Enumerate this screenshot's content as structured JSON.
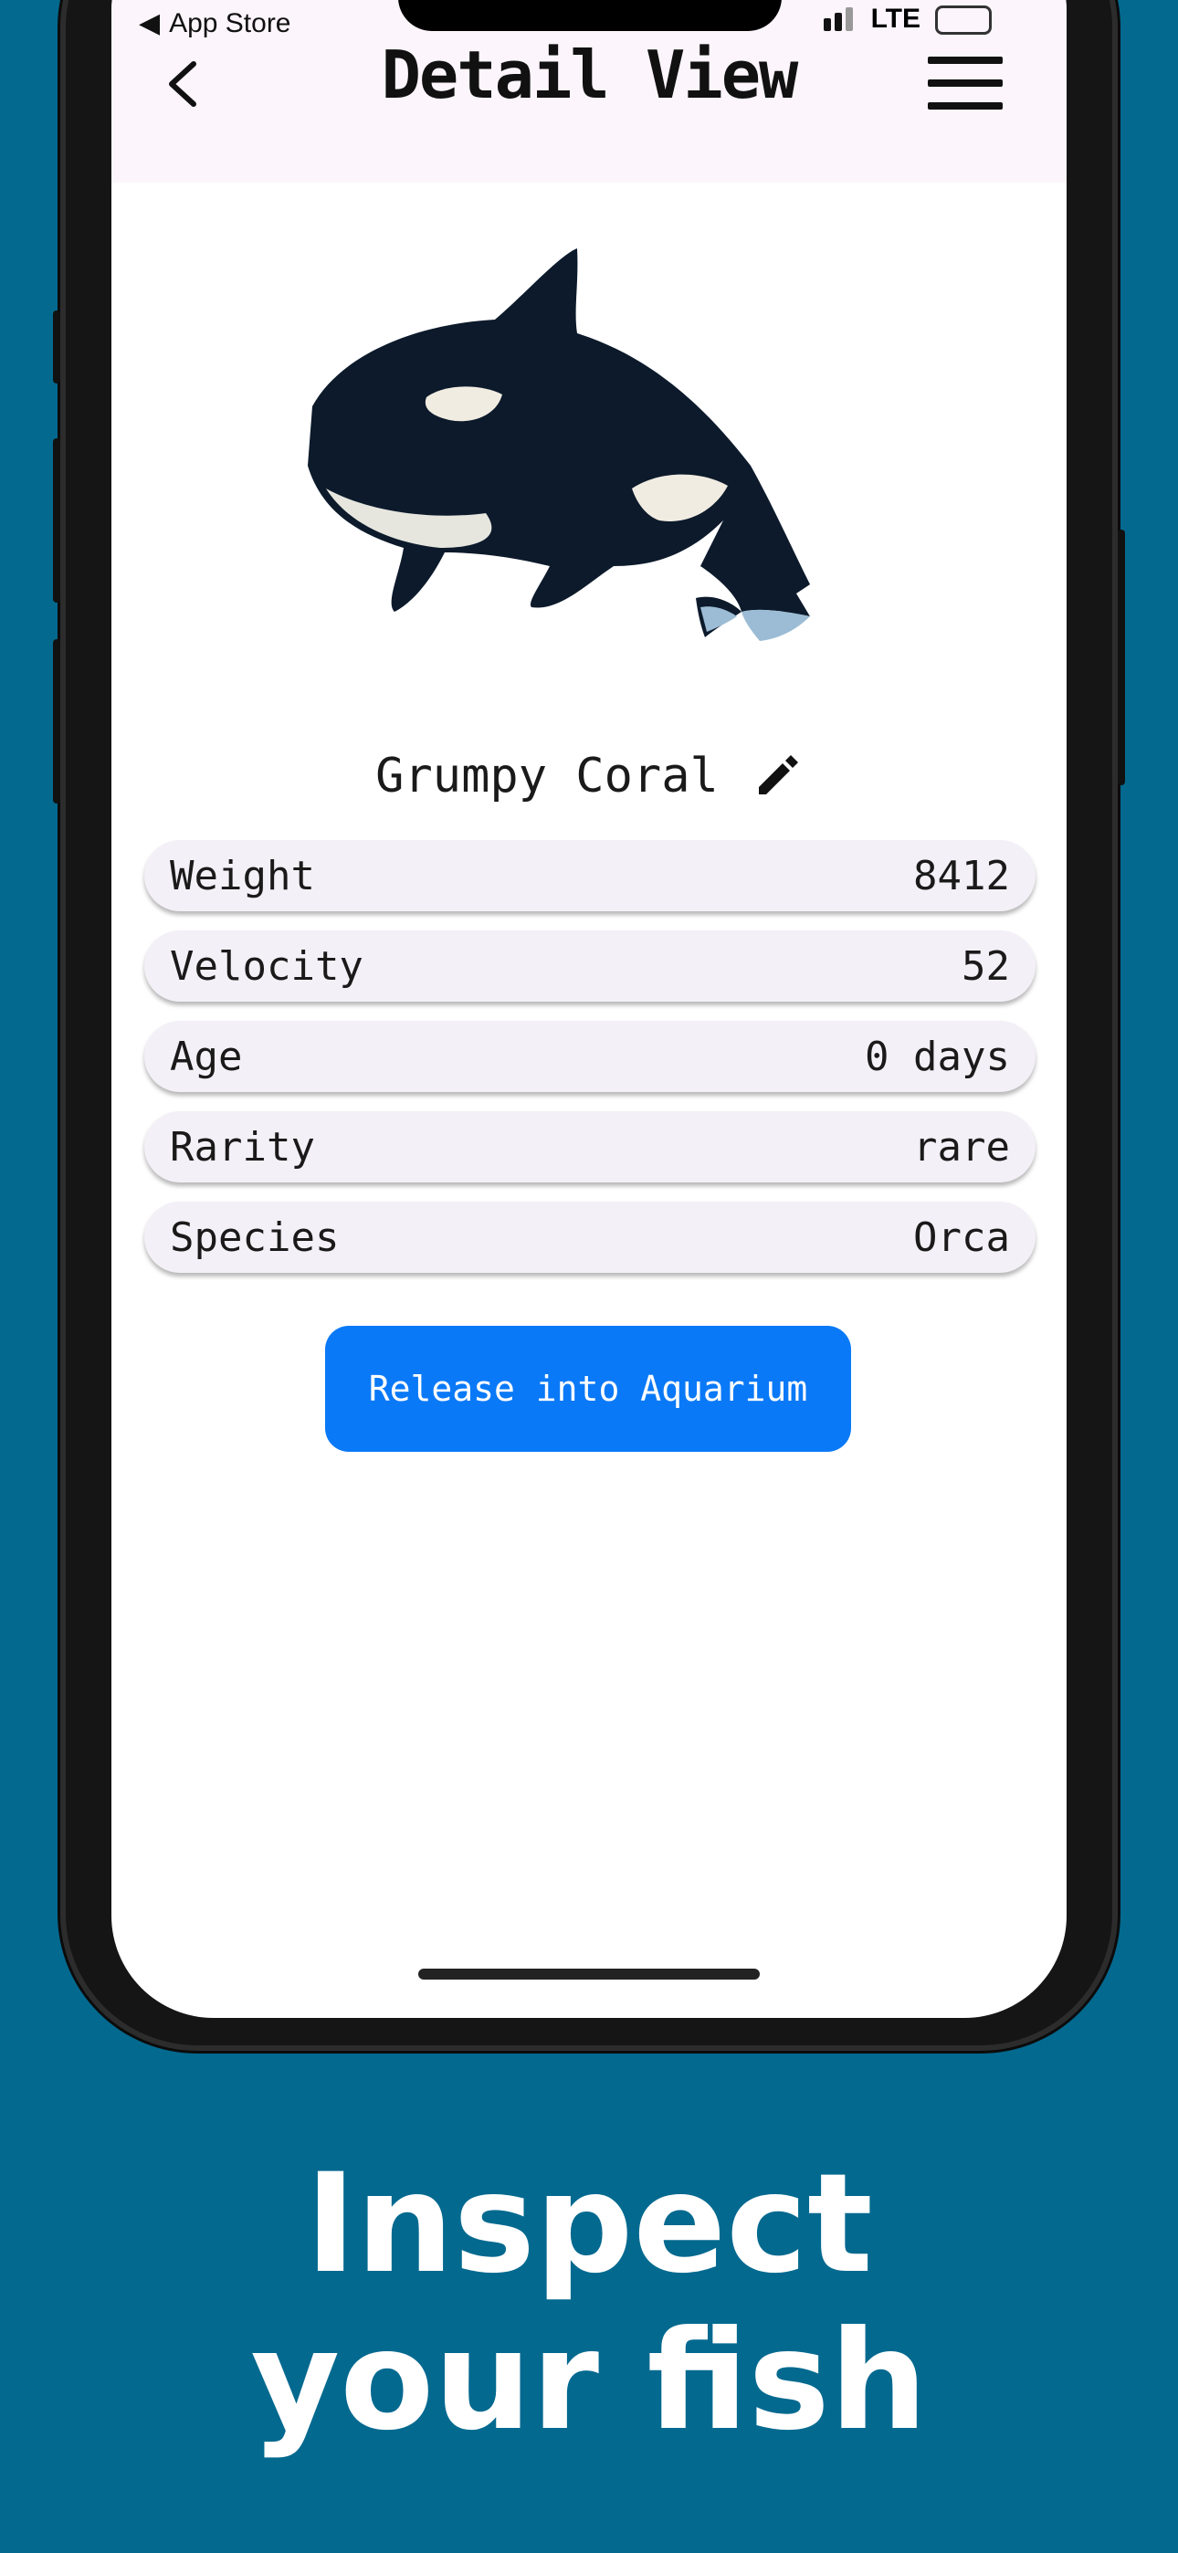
{
  "status_bar": {
    "back_label": "App Store",
    "network": "LTE"
  },
  "nav": {
    "title": "Detail View"
  },
  "fish": {
    "name": "Grumpy Coral",
    "stats": [
      {
        "label": "Weight",
        "value": "8412"
      },
      {
        "label": "Velocity",
        "value": "52"
      },
      {
        "label": "Age",
        "value": "0 days"
      },
      {
        "label": "Rarity",
        "value": "rare"
      },
      {
        "label": "Species",
        "value": "Orca"
      }
    ]
  },
  "actions": {
    "release_label": "Release into Aquarium"
  },
  "marketing": {
    "line1": "Inspect",
    "line2": "your fish"
  },
  "colors": {
    "background": "#03698f",
    "accent": "#0a79f7",
    "nav_bg": "#fcf5fb"
  },
  "icons": [
    "back-chevron-icon",
    "menu-icon",
    "edit-pencil-icon",
    "orca-image"
  ]
}
